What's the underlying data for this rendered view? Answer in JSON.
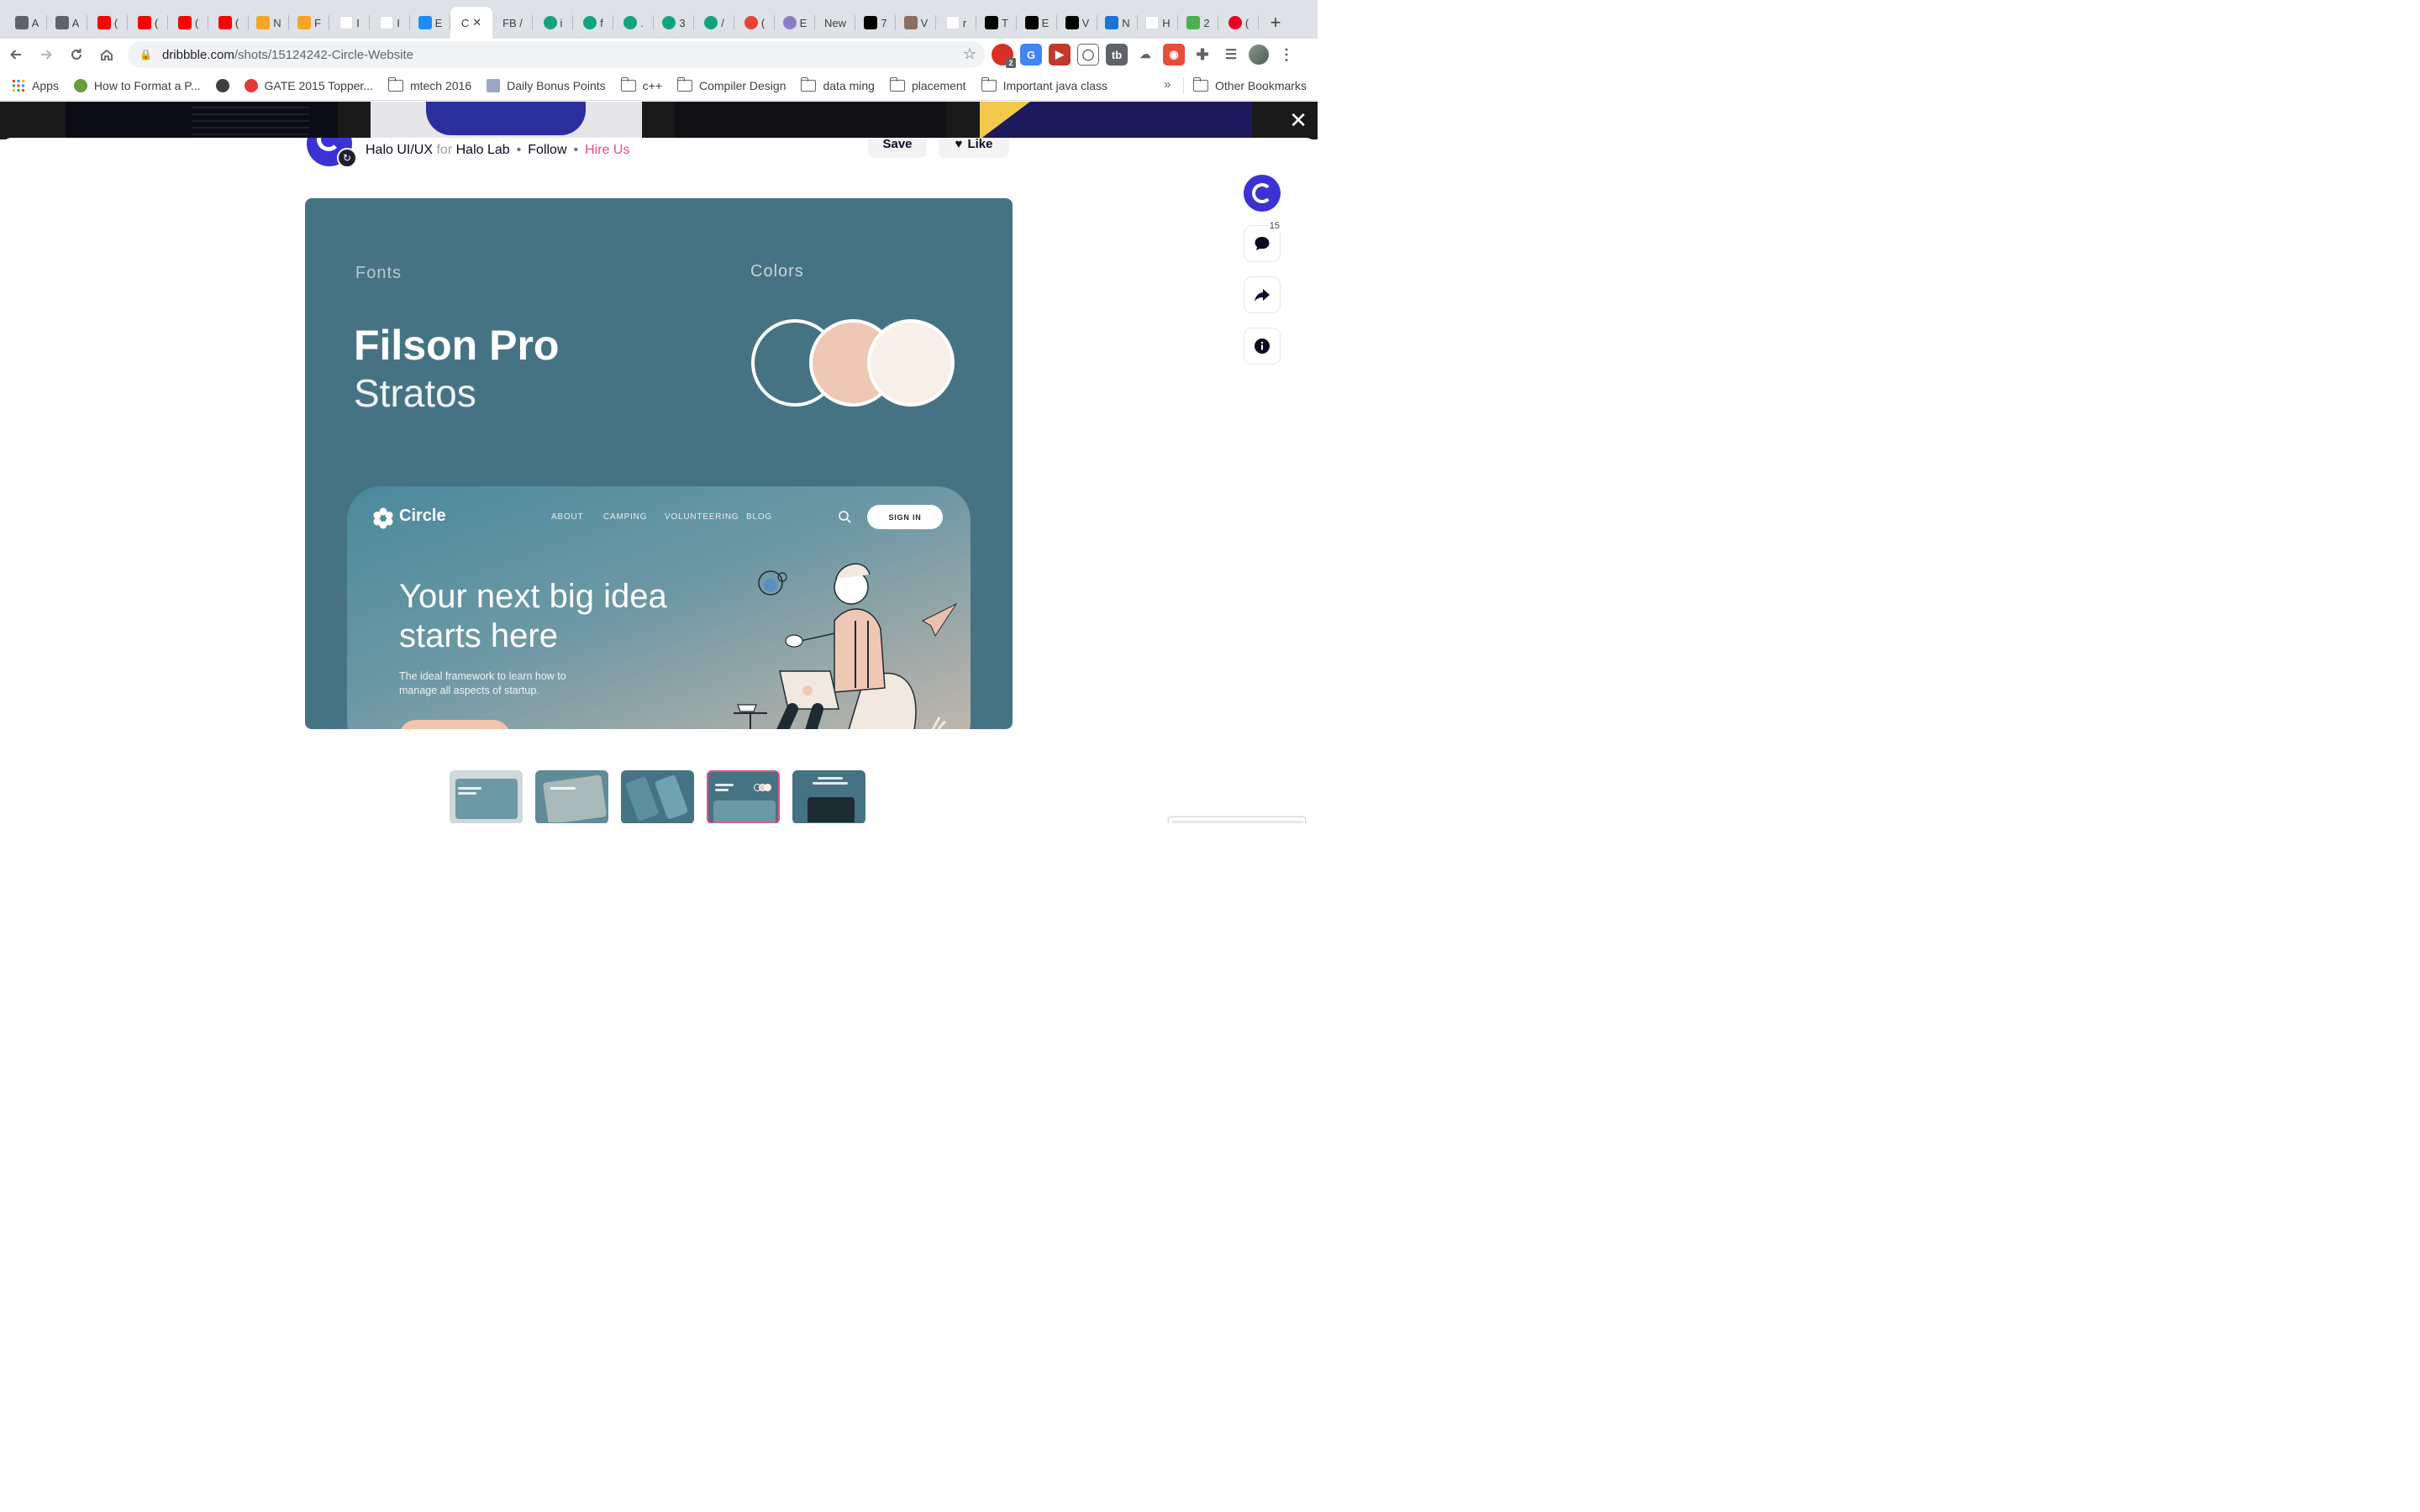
{
  "tabs": [
    {
      "fav": "apple",
      "title": "A"
    },
    {
      "fav": "apple",
      "title": "A"
    },
    {
      "fav": "youtube",
      "title": "("
    },
    {
      "fav": "youtube",
      "title": "("
    },
    {
      "fav": "youtube",
      "title": "("
    },
    {
      "fav": "youtube",
      "title": "("
    },
    {
      "fav": "firebase",
      "title": "N"
    },
    {
      "fav": "firebase",
      "title": "F"
    },
    {
      "fav": "gmail",
      "title": "I"
    },
    {
      "fav": "gmail",
      "title": "I"
    },
    {
      "fav": "appstore",
      "title": "E"
    },
    {
      "fav": "active",
      "title": "C"
    },
    {
      "fav": "fb-text",
      "title": "FB /"
    },
    {
      "fav": "openai",
      "title": "i"
    },
    {
      "fav": "openai",
      "title": "f"
    },
    {
      "fav": "openai",
      "title": "."
    },
    {
      "fav": "openai",
      "title": "3"
    },
    {
      "fav": "openai",
      "title": "/"
    },
    {
      "fav": "colorful",
      "title": "("
    },
    {
      "fav": "purple-swirl",
      "title": "E"
    },
    {
      "fav": "none",
      "title": "New"
    },
    {
      "fav": "medium",
      "title": "7"
    },
    {
      "fav": "art",
      "title": "V"
    },
    {
      "fav": "google",
      "title": "r"
    },
    {
      "fav": "medium",
      "title": "T"
    },
    {
      "fav": "medium",
      "title": "E"
    },
    {
      "fav": "medium",
      "title": "V"
    },
    {
      "fav": "blue-m",
      "title": "N"
    },
    {
      "fav": "google",
      "title": "H"
    },
    {
      "fav": "green-n",
      "title": "2"
    },
    {
      "fav": "pinterest",
      "title": "("
    }
  ],
  "toolbar": {
    "url_host": "dribbble.com",
    "url_path": "/shots/15124242-Circle-Website",
    "ext_badge": "2"
  },
  "bookmarks": {
    "apps": "Apps",
    "items": [
      {
        "label": "How to Format a P...",
        "icon": "wh-icon"
      },
      {
        "label": "",
        "icon": "globe-icon"
      },
      {
        "label": "GATE 2015 Topper...",
        "icon": "gate-icon"
      },
      {
        "label": "mtech 2016",
        "icon": "folder-icon"
      },
      {
        "label": "Daily Bonus Points",
        "icon": "bonus-icon"
      },
      {
        "label": "c++",
        "icon": "folder-icon"
      },
      {
        "label": "Compiler Design",
        "icon": "folder-icon"
      },
      {
        "label": "data ming",
        "icon": "folder-icon"
      },
      {
        "label": "placement",
        "icon": "folder-icon"
      },
      {
        "label": "Important java class",
        "icon": "folder-icon"
      }
    ],
    "more": "»",
    "other": "Other Bookmarks"
  },
  "author": {
    "name": "Halo UI/UX",
    "for_word": "for",
    "team": "Halo Lab",
    "follow": "Follow",
    "hire": "Hire Us",
    "save": "Save",
    "like": "Like"
  },
  "shot": {
    "fonts_label": "Fonts",
    "colors_label": "Colors",
    "font_primary": "Filson Pro",
    "font_secondary": "Stratos",
    "swatches": [
      "#467384",
      "#efc8b5",
      "#f6f0e8"
    ]
  },
  "site": {
    "logo": "Circle",
    "nav": [
      "ABOUT",
      "CAMPING",
      "VOLUNTEERING",
      "BLOG"
    ],
    "sign_in": "SIGN IN",
    "headline": "Your next big idea starts here",
    "sub": "The ideal framework to learn how to manage all aspects of startup."
  },
  "side": {
    "comment_count": "15"
  },
  "colors": {
    "dribbble_pink": "#ea4c89",
    "brand_blue": "#3b32d3",
    "shot_bg": "#467384"
  }
}
